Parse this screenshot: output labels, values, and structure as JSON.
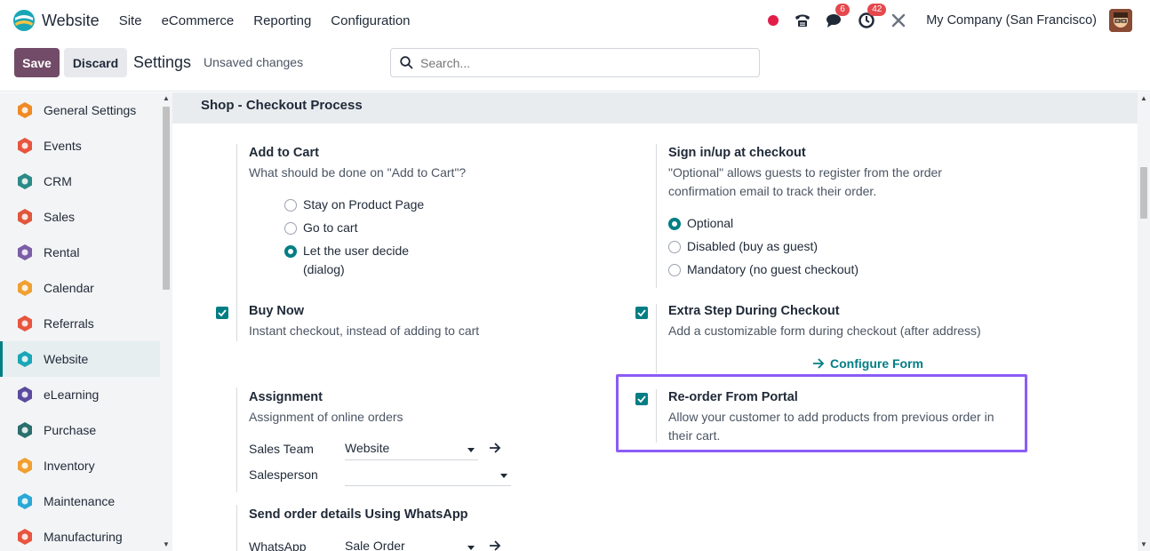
{
  "navbar": {
    "app_name": "Website",
    "menu": [
      "Site",
      "eCommerce",
      "Reporting",
      "Configuration"
    ],
    "messages_badge": "6",
    "activities_badge": "42",
    "company": "My Company (San Francisco)"
  },
  "control": {
    "save_label": "Save",
    "discard_label": "Discard",
    "title": "Settings",
    "status": "Unsaved changes",
    "search_placeholder": "Search..."
  },
  "sidebar": {
    "items": [
      {
        "label": "General Settings",
        "icon": "general-settings-icon",
        "color": "#f08a24"
      },
      {
        "label": "Events",
        "icon": "events-icon",
        "color": "#e8553e"
      },
      {
        "label": "CRM",
        "icon": "crm-icon",
        "color": "#2b8a88"
      },
      {
        "label": "Sales",
        "icon": "sales-icon",
        "color": "#e0573c"
      },
      {
        "label": "Rental",
        "icon": "rental-icon",
        "color": "#7b5ea7"
      },
      {
        "label": "Calendar",
        "icon": "calendar-icon",
        "color": "#f0a030"
      },
      {
        "label": "Referrals",
        "icon": "referrals-icon",
        "color": "#e8553e"
      },
      {
        "label": "Website",
        "icon": "website-icon",
        "color": "#1aa6b7"
      },
      {
        "label": "eLearning",
        "icon": "elearning-icon",
        "color": "#5b4a9e"
      },
      {
        "label": "Purchase",
        "icon": "purchase-icon",
        "color": "#2b6e6e"
      },
      {
        "label": "Inventory",
        "icon": "inventory-icon",
        "color": "#f0a030"
      },
      {
        "label": "Maintenance",
        "icon": "maintenance-icon",
        "color": "#2aa8d6"
      },
      {
        "label": "Manufacturing",
        "icon": "manufacturing-icon",
        "color": "#e8553e"
      }
    ],
    "active": "Website"
  },
  "section": {
    "title": "Shop - Checkout Process",
    "add_to_cart": {
      "title": "Add to Cart",
      "desc": "What should be done on \"Add to Cart\"?",
      "options": [
        "Stay on Product Page",
        "Go to cart",
        "Let the user decide"
      ],
      "option3_line2": "(dialog)",
      "selected": "Let the user decide"
    },
    "signin": {
      "title": "Sign in/up at checkout",
      "desc_line1": "\"Optional\" allows guests to register from the order",
      "desc_line2": "confirmation email to track their order.",
      "options": [
        "Optional",
        "Disabled (buy as guest)",
        "Mandatory (no guest checkout)"
      ],
      "selected": "Optional"
    },
    "buy_now": {
      "title": "Buy Now",
      "desc": "Instant checkout, instead of adding to cart",
      "checked": true
    },
    "extra_step": {
      "title": "Extra Step During Checkout",
      "desc": "Add a customizable form during checkout (after address)",
      "link": "Configure Form",
      "checked": true
    },
    "assignment": {
      "title": "Assignment",
      "desc": "Assignment of online orders",
      "sales_team_label": "Sales Team",
      "sales_team_value": "Website",
      "salesperson_label": "Salesperson",
      "salesperson_value": ""
    },
    "reorder": {
      "title": "Re-order From Portal",
      "desc_line1": "Allow your customer to add products from previous order in",
      "desc_line2": "their cart.",
      "checked": true
    },
    "whatsapp": {
      "title": "Send order details Using WhatsApp",
      "field_label": "WhatsApp",
      "field_value": "Sale Order"
    }
  },
  "colors": {
    "primary": "#714b67",
    "teal": "#017e84",
    "highlight": "#8b5cf6"
  }
}
